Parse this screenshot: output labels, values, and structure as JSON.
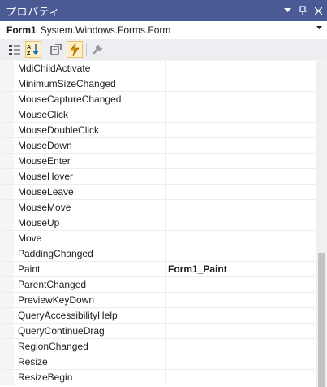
{
  "window": {
    "title": "プロパティ",
    "dropdown_icon": "chevron-down-icon",
    "pin_icon": "pin-icon",
    "close_icon": "close-icon"
  },
  "object_selector": {
    "name": "Form1",
    "type": "System.Windows.Forms.Form"
  },
  "toolbar": {
    "buttons": [
      "categorized-icon",
      "alphabetical-icon",
      "properties-icon",
      "events-icon",
      "property-pages-icon"
    ],
    "active": [
      "alphabetical-icon",
      "events-icon"
    ]
  },
  "events": [
    {
      "name": "MdiChildActivate",
      "value": ""
    },
    {
      "name": "MinimumSizeChanged",
      "value": ""
    },
    {
      "name": "MouseCaptureChanged",
      "value": ""
    },
    {
      "name": "MouseClick",
      "value": ""
    },
    {
      "name": "MouseDoubleClick",
      "value": ""
    },
    {
      "name": "MouseDown",
      "value": ""
    },
    {
      "name": "MouseEnter",
      "value": ""
    },
    {
      "name": "MouseHover",
      "value": ""
    },
    {
      "name": "MouseLeave",
      "value": ""
    },
    {
      "name": "MouseMove",
      "value": ""
    },
    {
      "name": "MouseUp",
      "value": ""
    },
    {
      "name": "Move",
      "value": ""
    },
    {
      "name": "PaddingChanged",
      "value": ""
    },
    {
      "name": "Paint",
      "value": "Form1_Paint"
    },
    {
      "name": "ParentChanged",
      "value": ""
    },
    {
      "name": "PreviewKeyDown",
      "value": ""
    },
    {
      "name": "QueryAccessibilityHelp",
      "value": ""
    },
    {
      "name": "QueryContinueDrag",
      "value": ""
    },
    {
      "name": "RegionChanged",
      "value": ""
    },
    {
      "name": "Resize",
      "value": ""
    },
    {
      "name": "ResizeBegin",
      "value": ""
    }
  ],
  "colors": {
    "title_bar": "#4a5a95",
    "active_button": "#fff0c2",
    "scroll_thumb": "#c2c3c9"
  }
}
